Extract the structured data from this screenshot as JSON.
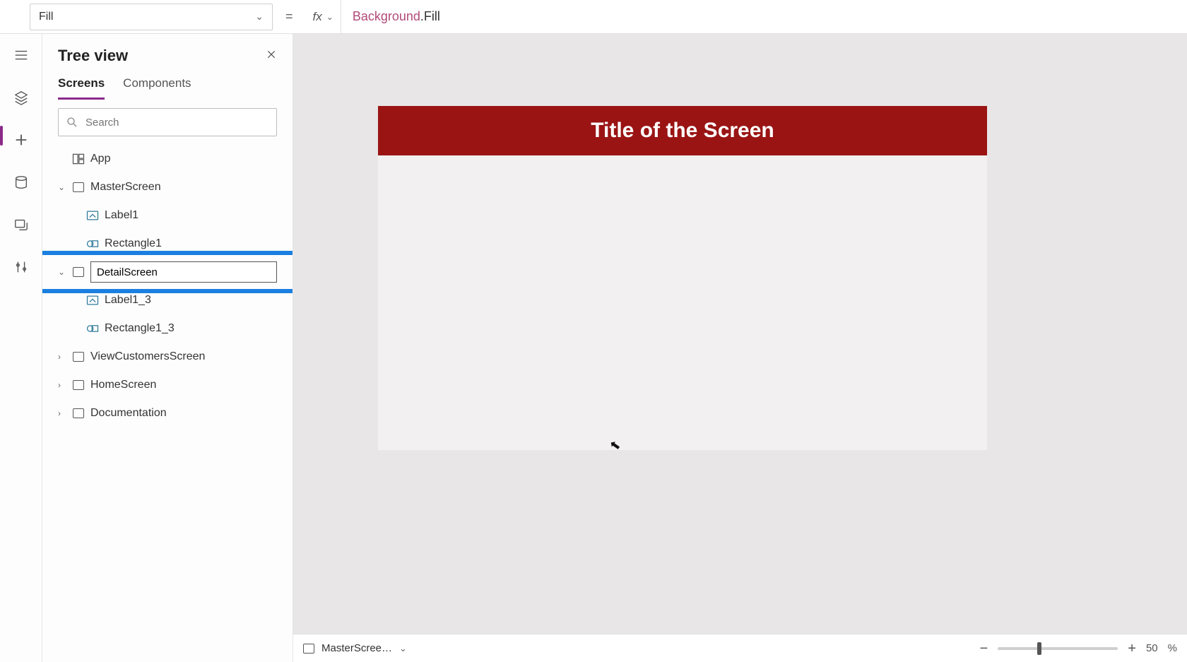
{
  "property_selector": {
    "value": "Fill"
  },
  "formula": {
    "fx": "fx",
    "identifier": "Background",
    "rest": ".Fill"
  },
  "tree_panel": {
    "title": "Tree view",
    "tabs": {
      "screens": "Screens",
      "components": "Components",
      "active": "screens"
    },
    "search_placeholder": "Search",
    "app_label": "App",
    "items": [
      {
        "name": "MasterScreen",
        "expanded": true,
        "children": [
          {
            "name": "Label1",
            "kind": "label"
          },
          {
            "name": "Rectangle1",
            "kind": "rect"
          }
        ]
      },
      {
        "name_editing": "DetailScreen",
        "expanded": true,
        "editing": true,
        "children": [
          {
            "name": "Label1_3",
            "kind": "label"
          },
          {
            "name": "Rectangle1_3",
            "kind": "rect"
          }
        ]
      },
      {
        "name": "ViewCustomersScreen",
        "expanded": false
      },
      {
        "name": "HomeScreen",
        "expanded": false
      },
      {
        "name": "Documentation",
        "expanded": false
      }
    ]
  },
  "canvas": {
    "title_text": "Title of the Screen",
    "title_bg": "#9a1414"
  },
  "bottom": {
    "selected_screen": "MasterScree…",
    "zoom_pct": "50",
    "zoom_suffix": "%",
    "thumb_pos_pct": 33
  }
}
